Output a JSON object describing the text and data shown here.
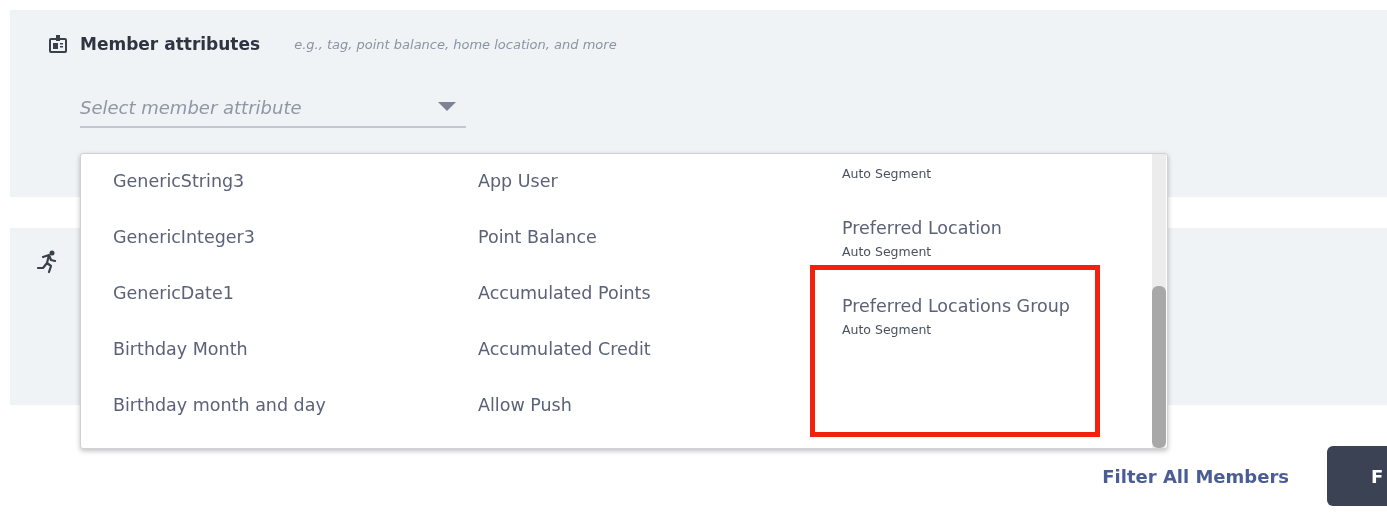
{
  "member_attributes": {
    "title": "Member attributes",
    "hint": "e.g., tag, point balance, home location, and more",
    "select": {
      "placeholder": "Select member attribute"
    }
  },
  "dropdown": {
    "columns": [
      {
        "items": [
          {
            "name": "GenericString3"
          },
          {
            "name": "GenericInteger3"
          },
          {
            "name": "GenericDate1"
          },
          {
            "name": "Birthday Month"
          },
          {
            "name": "Birthday month and day"
          }
        ]
      },
      {
        "items": [
          {
            "name": "App User"
          },
          {
            "name": "Point Balance"
          },
          {
            "name": "Accumulated Points"
          },
          {
            "name": "Accumulated Credit"
          },
          {
            "name": "Allow Push"
          }
        ]
      },
      {
        "items": [
          {
            "sub": "Auto Segment"
          },
          {
            "name": "Preferred Location",
            "sub": "Auto Segment"
          },
          {
            "name": "Preferred Locations Group",
            "sub": "Auto Segment",
            "highlighted": true
          }
        ]
      }
    ]
  },
  "footer": {
    "link": "Filter All Members",
    "button": "F"
  }
}
